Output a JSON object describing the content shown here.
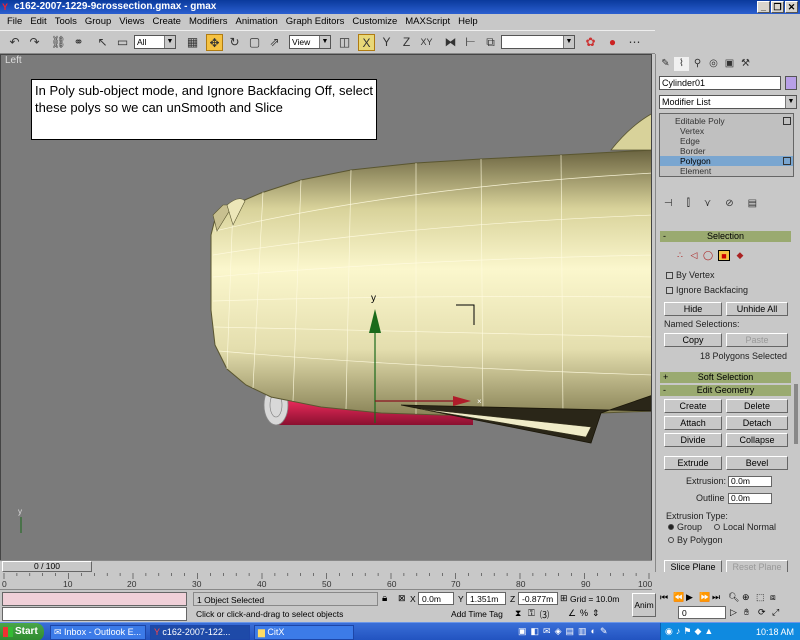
{
  "window": {
    "title": "c162-2007-1229-9crossection.gmax - gmax",
    "min": "_",
    "max": "❐",
    "close": "✕"
  },
  "menu": [
    "File",
    "Edit",
    "Tools",
    "Group",
    "Views",
    "Create",
    "Modifiers",
    "Animation",
    "Graph Editors",
    "Customize",
    "MAXScript",
    "Help"
  ],
  "toolbar": {
    "filter_value": "All",
    "refcoord_value": "View"
  },
  "viewport": {
    "label": "Left",
    "note": "In Poly sub-object mode, and Ignore Backfacing Off, select these polys so we can unSmooth and Slice",
    "axis_label": "y"
  },
  "panel": {
    "object_name": "Cylinder01",
    "object_color": "#b8a0e8",
    "modifier_list": "Modifier List",
    "stack": [
      "Editable Poly",
      "Vertex",
      "Edge",
      "Border",
      "Polygon",
      "Element"
    ],
    "stack_active": "Polygon",
    "selection": {
      "title": "Selection",
      "by_vertex": "By Vertex",
      "ignore_backfacing": "Ignore Backfacing",
      "hide": "Hide",
      "unhide_all": "Unhide All",
      "named_selections": "Named Selections:",
      "copy": "Copy",
      "paste": "Paste",
      "count": "18 Polygons Selected"
    },
    "soft_selection": {
      "title": "Soft Selection"
    },
    "edit_geometry": {
      "title": "Edit Geometry",
      "create": "Create",
      "delete": "Delete",
      "attach": "Attach",
      "detach": "Detach",
      "divide": "Divide",
      "collapse": "Collapse",
      "extrude": "Extrude",
      "bevel": "Bevel",
      "extrusion_label": "Extrusion:",
      "extrusion_value": "0.0m",
      "outline_label": "Outline",
      "outline_value": "0.0m",
      "extrusion_type": "Extrusion Type:",
      "group": "Group",
      "local_normal": "Local Normal",
      "by_polygon": "By Polygon",
      "slice_plane": "Slice Plane",
      "reset_plane": "Reset Plane"
    }
  },
  "timeline": {
    "frame": "0 / 100",
    "ticks": [
      "0",
      "10",
      "20",
      "30",
      "40",
      "50",
      "60",
      "70",
      "80",
      "90",
      "100"
    ]
  },
  "status": {
    "selected": "1 Object Selected",
    "prompt": "Click or click-and-drag to select objects",
    "x_label": "X",
    "x_value": "0.0m",
    "y_label": "Y",
    "y_value": "1.351m",
    "z_label": "Z",
    "z_value": "-0.877m",
    "grid": "Grid = 10.0m",
    "add_time_tag": "Add Time Tag",
    "anim": "Anim",
    "frame_spinner": "0"
  },
  "taskbar": {
    "start": "Start",
    "tasks": [
      "Inbox - Outlook E...",
      "c162-2007-122...",
      "CitX"
    ],
    "clock": "10:18 AM"
  }
}
